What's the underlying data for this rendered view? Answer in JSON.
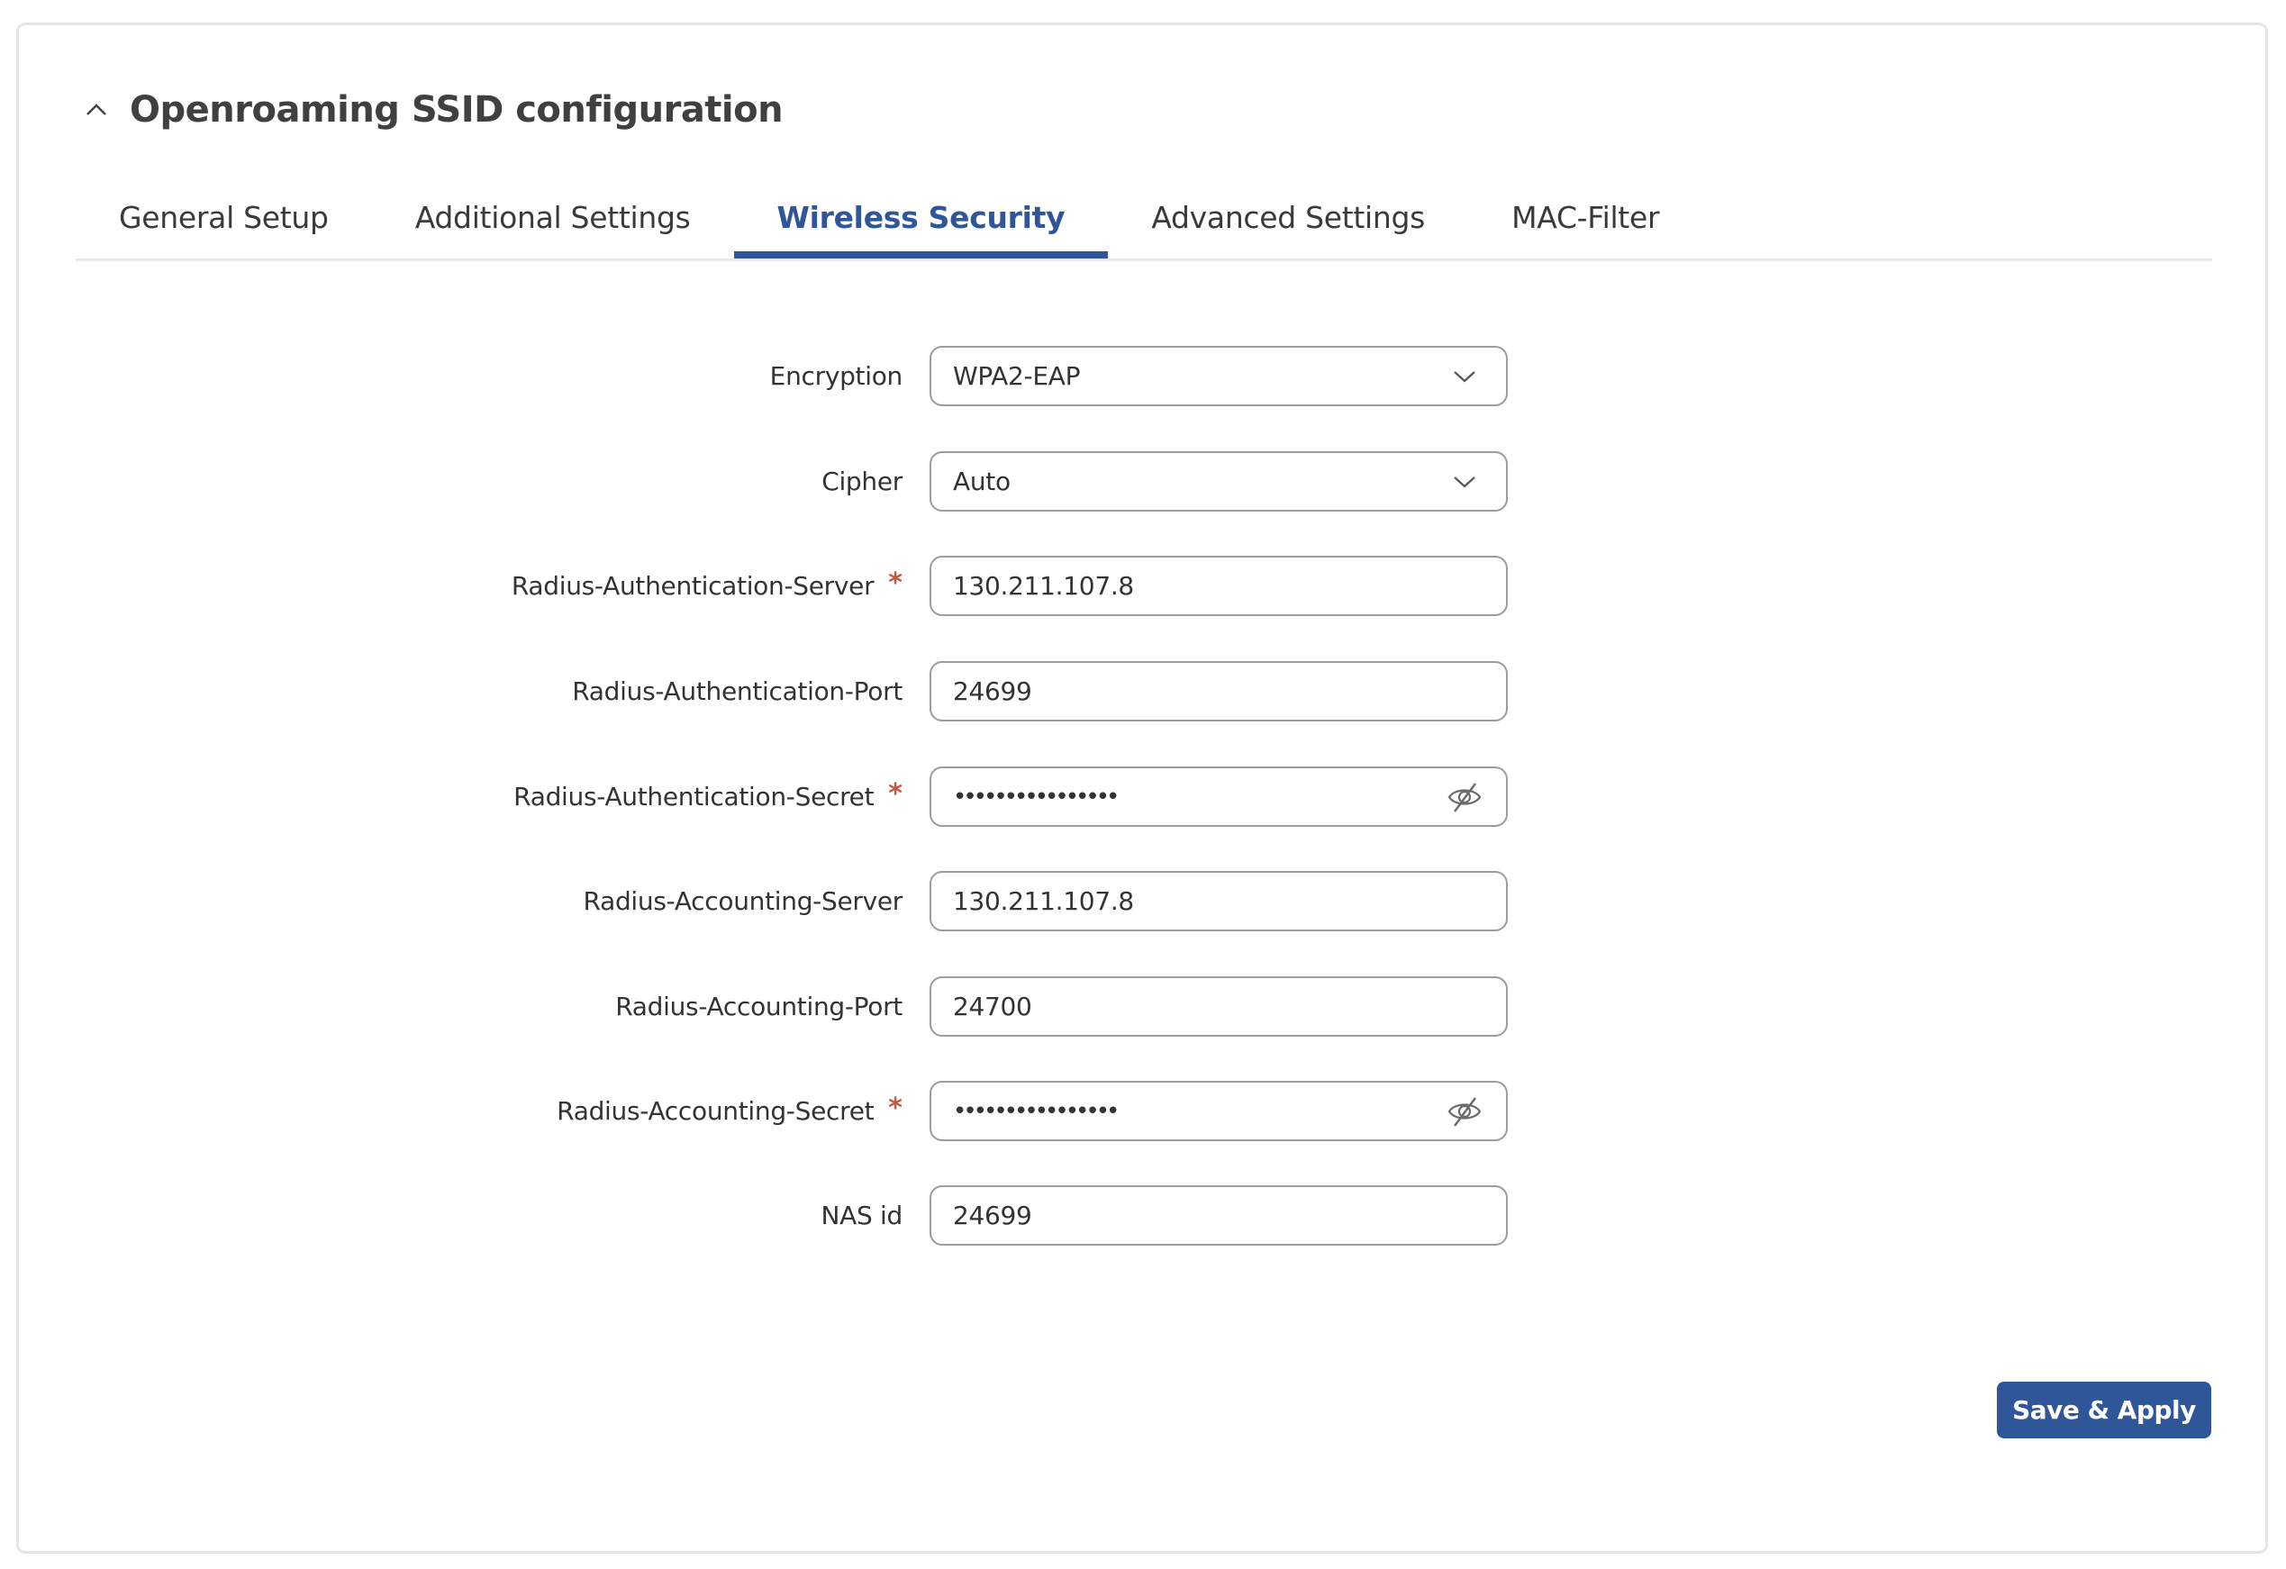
{
  "section": {
    "title": "Openroaming SSID configuration",
    "expanded": true
  },
  "tabs": [
    {
      "label": "General Setup",
      "active": false
    },
    {
      "label": "Additional Settings",
      "active": false
    },
    {
      "label": "Wireless Security",
      "active": true
    },
    {
      "label": "Advanced Settings",
      "active": false
    },
    {
      "label": "MAC-Filter",
      "active": false
    }
  ],
  "form": {
    "encryption": {
      "label": "Encryption",
      "value": "WPA2-EAP",
      "type": "select"
    },
    "cipher": {
      "label": "Cipher",
      "value": "Auto",
      "type": "select"
    },
    "radius_auth_server": {
      "label": "Radius-Authentication-Server",
      "required": true,
      "value": "130.211.107.8"
    },
    "radius_auth_port": {
      "label": "Radius-Authentication-Port",
      "value": "24699"
    },
    "radius_auth_secret": {
      "label": "Radius-Authentication-Secret",
      "required": true,
      "masked_value": "••••••••••••••••",
      "visibility_icon": "eye-off-icon"
    },
    "radius_acct_server": {
      "label": "Radius-Accounting-Server",
      "value": "130.211.107.8"
    },
    "radius_acct_port": {
      "label": "Radius-Accounting-Port",
      "value": "24700"
    },
    "radius_acct_secret": {
      "label": "Radius-Accounting-Secret",
      "required": true,
      "masked_value": "••••••••••••••••",
      "visibility_icon": "eye-off-icon"
    },
    "nas_id": {
      "label": "NAS id",
      "value": "24699"
    },
    "required_marker": "*"
  },
  "actions": {
    "save_apply_label": "Save & Apply"
  },
  "colors": {
    "accent": "#2f5699",
    "required": "#c8553d",
    "border": "#9b9ba2"
  }
}
